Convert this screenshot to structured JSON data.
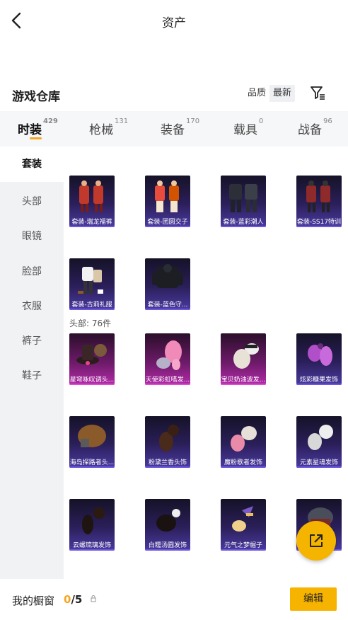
{
  "header": {
    "title": "资产"
  },
  "warehouse": {
    "title": "游戏仓库",
    "sort_options": [
      "品质",
      "最新"
    ],
    "filter_icon": "filter-icon"
  },
  "tabs": [
    {
      "label": "时装",
      "count": "429"
    },
    {
      "label": "枪械",
      "count": "131"
    },
    {
      "label": "装备",
      "count": "170"
    },
    {
      "label": "载具",
      "count": "0"
    },
    {
      "label": "战备",
      "count": "96"
    }
  ],
  "sidebar": [
    "套装",
    "头部",
    "眼镜",
    "脸部",
    "衣服",
    "裤子",
    "鞋子"
  ],
  "suits": [
    "套装-瑞龙福裤",
    "套装-团圆交子",
    "套装-蓝彩潮人",
    "套装-SS17特训",
    "套装-古莉礼服",
    "套装-蓝色守..."
  ],
  "head_group": {
    "title": "头部: 76件",
    "items": [
      "星穹咏叹调头...",
      "天使彩虹嗒发...",
      "宝贝奶油波发...",
      "炫彩糖果发饰",
      "海岛探路者头...",
      "粉黛兰香头饰",
      "魔粉歌者发饰",
      "元素星魂发饰",
      "云螺琉璃发饰",
      "白糯汤圆发饰",
      "元气之梦帽子"
    ]
  },
  "bottom": {
    "wardrobe_label": "我的橱窗",
    "used": "0",
    "total": "/5",
    "edit_label": "编辑"
  },
  "colors": {
    "accent": "#f5a623",
    "button": "#f6b300"
  }
}
